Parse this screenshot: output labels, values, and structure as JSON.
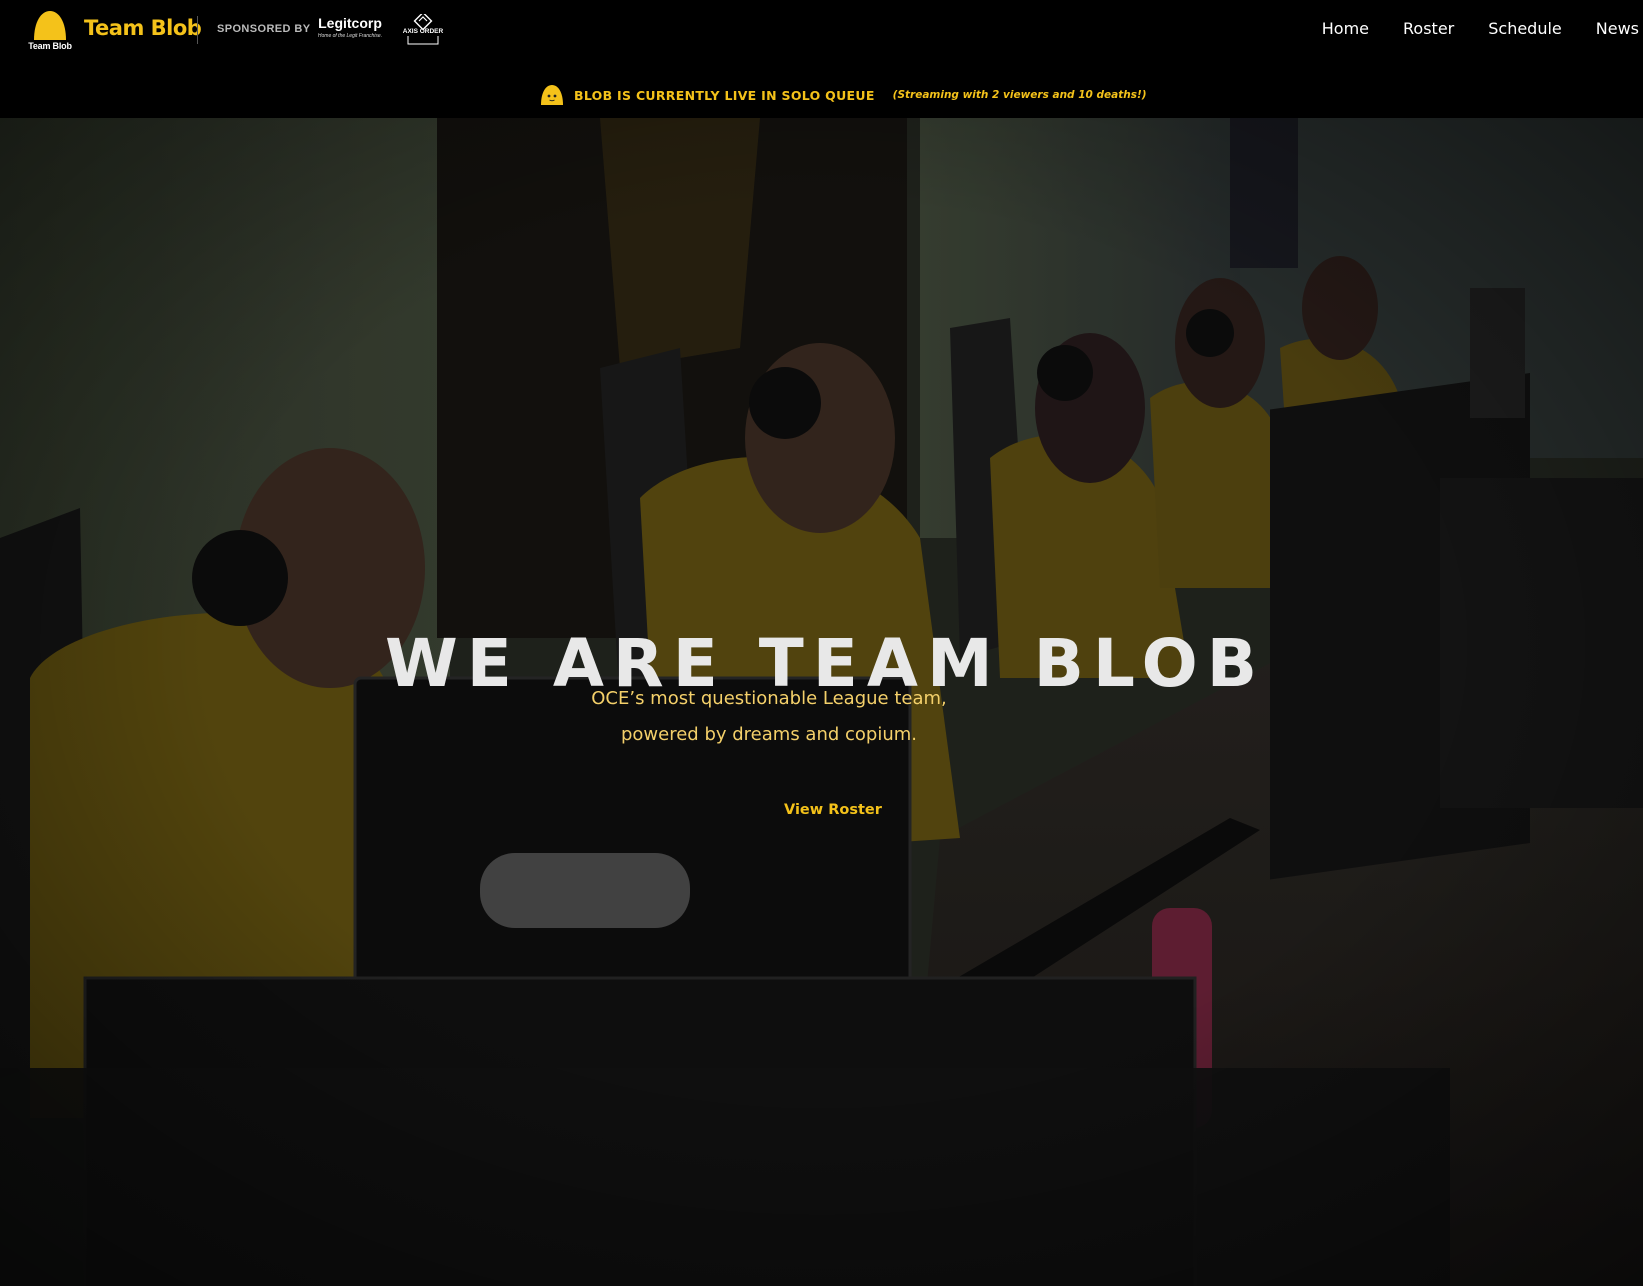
{
  "brand": {
    "logo_word": "Team Blob",
    "name": "Team Blob",
    "accent_color": "#f4c21a"
  },
  "sponsors": {
    "label": "SPONSORED BY",
    "legitcorp": {
      "name": "Legitcorp",
      "tagline": "Home of the Legit Franchise."
    },
    "axis_order": {
      "name": "AXIS ORDER"
    }
  },
  "nav": {
    "items": [
      {
        "label": "Home"
      },
      {
        "label": "Roster"
      },
      {
        "label": "Schedule"
      },
      {
        "label": "News"
      }
    ]
  },
  "live_banner": {
    "icon": "blob-face-icon",
    "main": "BLOB IS CURRENTLY LIVE IN SOLO QUEUE",
    "sub": "(Streaming with 2 viewers and 10 deaths!)"
  },
  "hero": {
    "title": "WE ARE TEAM BLOB",
    "subtitle_line1": "OCE’s most questionable League team,",
    "subtitle_line2": "powered by dreams and copium.",
    "cta": "View Roster",
    "image": "esports-team-gaming-photo"
  }
}
